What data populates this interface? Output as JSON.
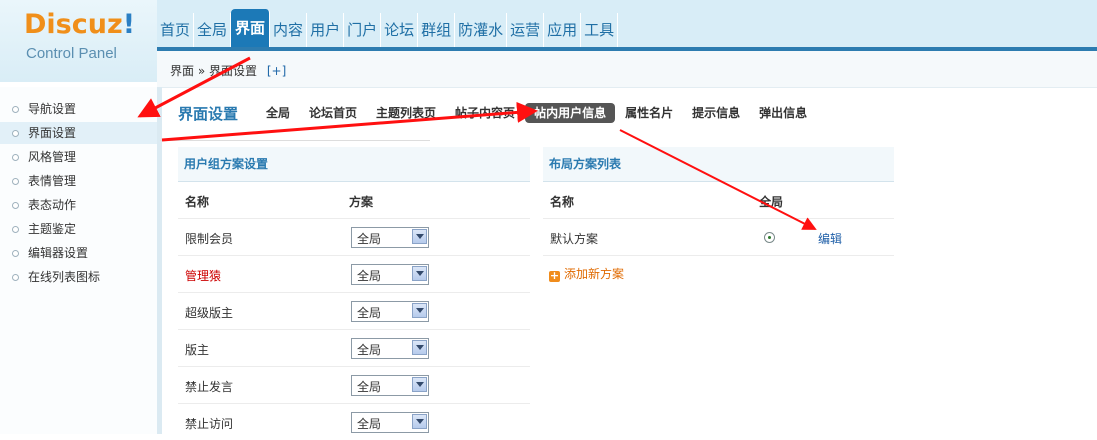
{
  "logo": {
    "main": "Discuz",
    "bang": "!",
    "sub": "Control Panel"
  },
  "topnav": [
    "首页",
    "全局",
    "界面",
    "内容",
    "用户",
    "门户",
    "论坛",
    "群组",
    "防灌水",
    "运营",
    "应用",
    "工具"
  ],
  "topnav_active": "界面",
  "breadcrumb": {
    "root": "界面",
    "sep": "»",
    "current": "界面设置",
    "add": "[+]"
  },
  "sidebar": [
    "导航设置",
    "界面设置",
    "风格管理",
    "表情管理",
    "表态动作",
    "主题鉴定",
    "编辑器设置",
    "在线列表图标"
  ],
  "sidebar_active": "界面设置",
  "page_title": "界面设置",
  "tabs": [
    "全局",
    "论坛首页",
    "主题列表页",
    "帖子内容页",
    "帖内用户信息",
    "属性名片",
    "提示信息",
    "弹出信息"
  ],
  "tab_active": "帖内用户信息",
  "left_panel": {
    "title": "用户组方案设置",
    "headers": [
      "名称",
      "方案"
    ],
    "rows": [
      {
        "name": "限制会员",
        "value": "全局",
        "red": false
      },
      {
        "name": "管理猿",
        "value": "全局",
        "red": true
      },
      {
        "name": "超级版主",
        "value": "全局",
        "red": false
      },
      {
        "name": "版主",
        "value": "全局",
        "red": false
      },
      {
        "name": "禁止发言",
        "value": "全局",
        "red": false
      },
      {
        "name": "禁止访问",
        "value": "全局",
        "red": false
      }
    ]
  },
  "right_panel": {
    "title": "布局方案列表",
    "headers": [
      "名称",
      "全局"
    ],
    "rows": [
      {
        "name": "默认方案",
        "action": "编辑"
      }
    ],
    "add_label": "添加新方案"
  },
  "colors": {
    "accent": "#1c79b7",
    "annotation": "#ff0000",
    "add": "#e06a00"
  }
}
